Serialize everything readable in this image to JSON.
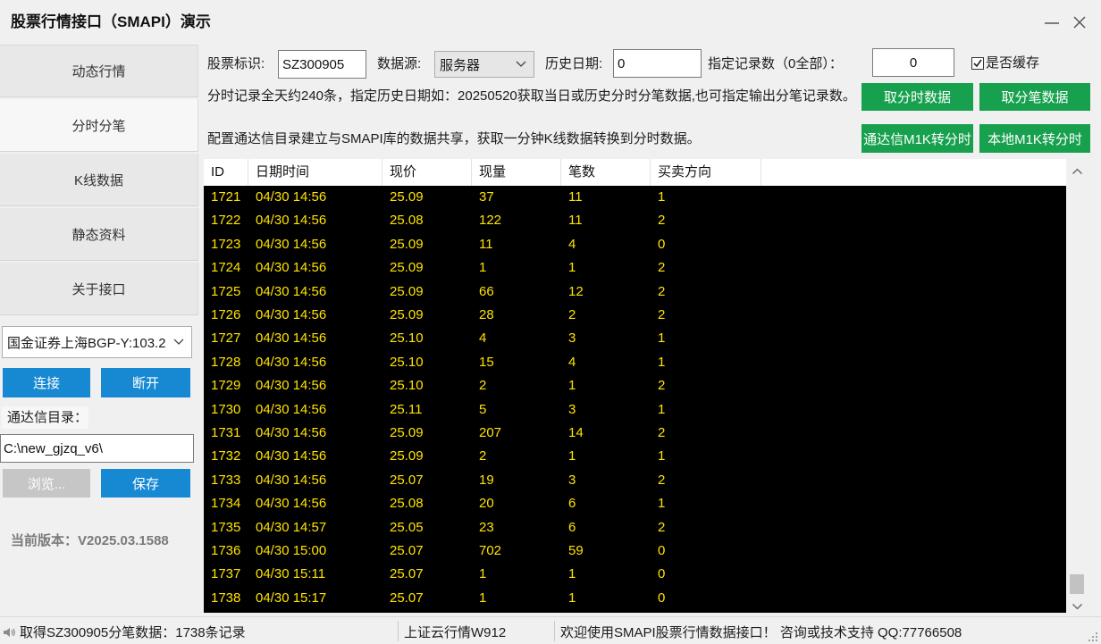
{
  "window": {
    "title": "股票行情接口（SMAPI）演示",
    "minimize_icon": "minimize-icon",
    "close_icon": "close-icon"
  },
  "sidebar": {
    "nav": [
      {
        "label": "动态行情",
        "selected": false
      },
      {
        "label": "分时分笔",
        "selected": true
      },
      {
        "label": "K线数据",
        "selected": false
      },
      {
        "label": "静态资料",
        "selected": false
      },
      {
        "label": "关于接口",
        "selected": false
      }
    ],
    "server_select": {
      "value": "国金证券上海BGP-Y:103.2"
    },
    "connect_label": "连接",
    "disconnect_label": "断开",
    "tdx_dir": {
      "label": "通达信目录：",
      "value": "C:\\new_gjzq_v6\\"
    },
    "browse_label": "浏览...",
    "save_label": "保存",
    "version": "当前版本：V2025.03.1588"
  },
  "query": {
    "stock_id": {
      "label": "股票标识:",
      "value": "SZ300905"
    },
    "data_source": {
      "label": "数据源:",
      "value": "服务器"
    },
    "history_date": {
      "label": "历史日期:",
      "value": "0"
    },
    "record_count": {
      "label": "指定记录数（0全部）：",
      "value": "0"
    },
    "cache": {
      "label": "是否缓存",
      "checked": true
    },
    "hint_minute": "分时记录全天约240条，指定历史日期如：20250520获取当日或历史分时分笔数据,也可指定输出分笔记录数。",
    "hint_m1k": "配置通达信目录建立与SMAPI库的数据共享，获取一分钟K线数据转换到分时数据。",
    "buttons": {
      "get_minute": "取分时数据",
      "get_tick": "取分笔数据",
      "tdx_m1k": "通达信M1K转分时",
      "local_m1k": "本地M1K转分时"
    }
  },
  "table": {
    "columns": [
      "ID",
      "日期时间",
      "现价",
      "现量",
      "笔数",
      "买卖方向"
    ],
    "rows": [
      [
        "1721",
        "04/30 14:56",
        "25.09",
        "37",
        "11",
        "1"
      ],
      [
        "1722",
        "04/30 14:56",
        "25.08",
        "122",
        "11",
        "2"
      ],
      [
        "1723",
        "04/30 14:56",
        "25.09",
        "11",
        "4",
        "0"
      ],
      [
        "1724",
        "04/30 14:56",
        "25.09",
        "1",
        "1",
        "2"
      ],
      [
        "1725",
        "04/30 14:56",
        "25.09",
        "66",
        "12",
        "2"
      ],
      [
        "1726",
        "04/30 14:56",
        "25.09",
        "28",
        "2",
        "2"
      ],
      [
        "1727",
        "04/30 14:56",
        "25.10",
        "4",
        "3",
        "1"
      ],
      [
        "1728",
        "04/30 14:56",
        "25.10",
        "15",
        "4",
        "1"
      ],
      [
        "1729",
        "04/30 14:56",
        "25.10",
        "2",
        "1",
        "2"
      ],
      [
        "1730",
        "04/30 14:56",
        "25.11",
        "5",
        "3",
        "1"
      ],
      [
        "1731",
        "04/30 14:56",
        "25.09",
        "207",
        "14",
        "2"
      ],
      [
        "1732",
        "04/30 14:56",
        "25.09",
        "2",
        "1",
        "1"
      ],
      [
        "1733",
        "04/30 14:56",
        "25.07",
        "19",
        "3",
        "2"
      ],
      [
        "1734",
        "04/30 14:56",
        "25.08",
        "20",
        "6",
        "1"
      ],
      [
        "1735",
        "04/30 14:57",
        "25.05",
        "23",
        "6",
        "2"
      ],
      [
        "1736",
        "04/30 15:00",
        "25.07",
        "702",
        "59",
        "0"
      ],
      [
        "1737",
        "04/30 15:11",
        "25.07",
        "1",
        "1",
        "0"
      ],
      [
        "1738",
        "04/30 15:17",
        "25.07",
        "1",
        "1",
        "0"
      ]
    ]
  },
  "status": {
    "icon": "speaker-icon",
    "message": "取得SZ300905分笔数据：1738条记录",
    "server": "上证云行情W912",
    "welcome": "欢迎使用SMAPI股票行情数据接口！ 咨询或技术支持 QQ:77766508"
  },
  "colors": {
    "button_blue": "#1789d3",
    "button_green": "#17a14e",
    "table_background": "#000000",
    "table_text": "#ffe400"
  }
}
